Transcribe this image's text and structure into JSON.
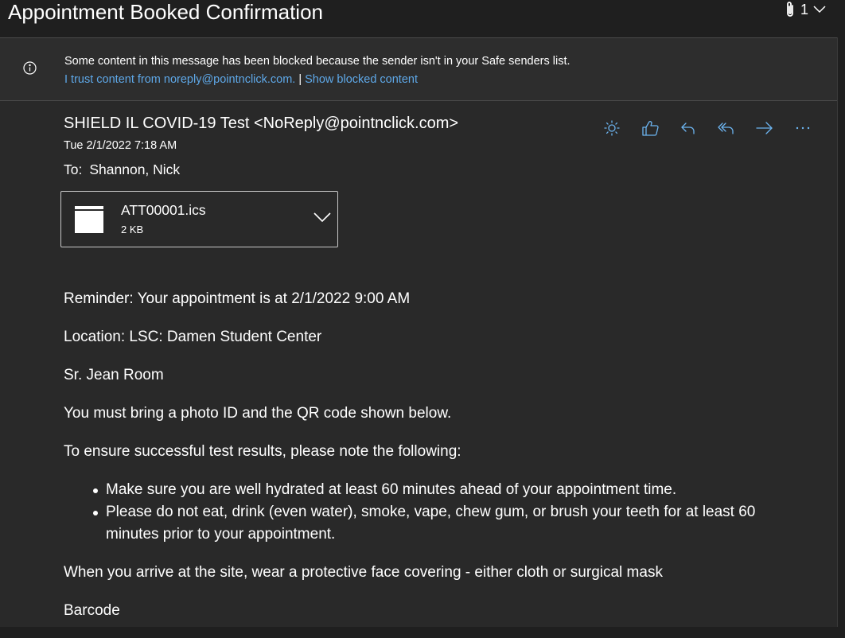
{
  "email": {
    "subject": "Appointment Booked Confirmation",
    "attachment_count": "1",
    "banner": {
      "message": "Some content in this message has been blocked because the sender isn't in your Safe senders list.",
      "trust_link": "I trust content from noreply@pointnclick.com.",
      "separator": "|",
      "show_link": "Show blocked content"
    },
    "sender": "SHIELD IL COVID-19 Test <NoReply@pointnclick.com>",
    "date": "Tue 2/1/2022 7:18 AM",
    "to_label": "To:",
    "to_value": "Shannon, Nick",
    "attachment": {
      "name": "ATT00001.ics",
      "size": "2 KB",
      "icon": "calendar-icon"
    },
    "actions": [
      "sun-icon",
      "like-icon",
      "reply-icon",
      "reply-all-icon",
      "forward-icon",
      "more-icon"
    ],
    "body": {
      "line1": "Reminder: Your appointment is at 2/1/2022 9:00 AM",
      "line2": "Location: LSC: Damen Student Center",
      "line3": "Sr. Jean Room",
      "line4": "You must bring a photo ID and the QR code shown below.",
      "line5": "To ensure successful test results, please note the following:",
      "bullets": [
        "Make sure you are well hydrated at least 60 minutes ahead of your appointment time.",
        "Please do not eat, drink (even water), smoke, vape, chew gum, or brush your teeth for at least 60 minutes prior to your appointment."
      ],
      "line6": "When you arrive at the site, wear a protective face covering - either cloth or surgical mask",
      "line7": "Barcode"
    }
  },
  "colors": {
    "background": "#292929",
    "titlebar": "#1f1f1f",
    "banner": "#2d2d2d",
    "link": "#5ea8e8",
    "icon_accent": "#6cb4f0"
  }
}
